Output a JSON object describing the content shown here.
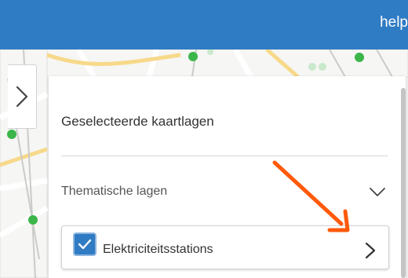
{
  "header": {
    "help_label": "help",
    "background_color": "#2f7bc4"
  },
  "sidebar_toggle": {
    "icon": "chevron-right-icon"
  },
  "panel": {
    "title": "Geselecteerde kaartlagen",
    "section_label": "Thematische lagen",
    "section_icon": "chevron-down-icon"
  },
  "layer": {
    "label": "Elektriciteitsstations",
    "checked": true,
    "checkbox_color": "#2f7bc4",
    "icon": "chevron-right-icon"
  },
  "annotation": {
    "arrow_color": "#ff5a0a"
  }
}
